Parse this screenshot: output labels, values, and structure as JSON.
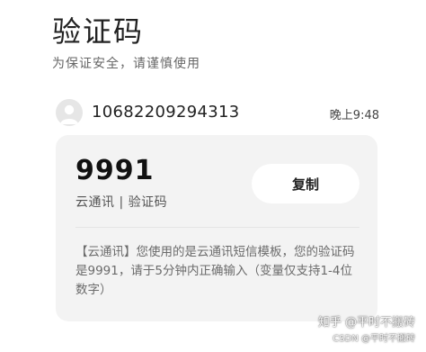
{
  "header": {
    "title": "验证码",
    "subtitle": "为保证安全，请谨慎使用"
  },
  "message": {
    "sender": "10682209294313",
    "time": "晚上9:48",
    "avatar_icon": "person-icon"
  },
  "card": {
    "code": "9991",
    "source": "云通讯 | 验证码",
    "copy_label": "复制",
    "body": "【云通讯】您使用的是云通讯短信模板，您的验证码是9991，请于5分钟内正确输入（变量仅支持1-4位数字）"
  },
  "watermark": {
    "main": "知乎 @平时不搬砖",
    "sub": "CSDN @平时不搬砖"
  },
  "colors": {
    "card_background": "#f3f3f3",
    "button_background": "#ffffff",
    "avatar_background": "#e6e6e6"
  }
}
